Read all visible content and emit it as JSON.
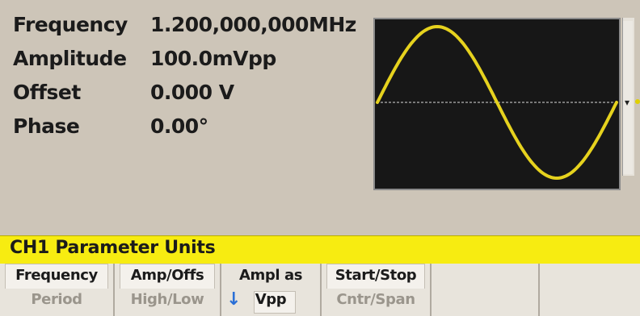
{
  "parameters": [
    {
      "label": "Frequency",
      "value": "1.200,000,000MHz"
    },
    {
      "label": "Amplitude",
      "value": "100.0mVpp"
    },
    {
      "label": "Offset",
      "value": "0.000 V"
    },
    {
      "label": "Phase",
      "value": "0.00°"
    }
  ],
  "waveform": {
    "type": "sine",
    "cycles": 1,
    "trace_color": "#e6d21e",
    "background_color": "#171717",
    "baseline_color": "#9a9a9a"
  },
  "menu": {
    "title": "CH1 Parameter Units",
    "title_color": "#f7ec11"
  },
  "softkeys": [
    {
      "line1": "Frequency",
      "line2": "Period"
    },
    {
      "line1": "Amp/Offs",
      "line2": "High/Low"
    },
    {
      "line1": "Ampl as",
      "line2": "Vpp",
      "arrow_icon": "down-arrow-icon",
      "arrow": "↓"
    },
    {
      "line1": "Start/Stop",
      "line2": "Cntr/Span"
    },
    {
      "line1": "",
      "line2": ""
    },
    {
      "line1": "",
      "line2": ""
    }
  ]
}
